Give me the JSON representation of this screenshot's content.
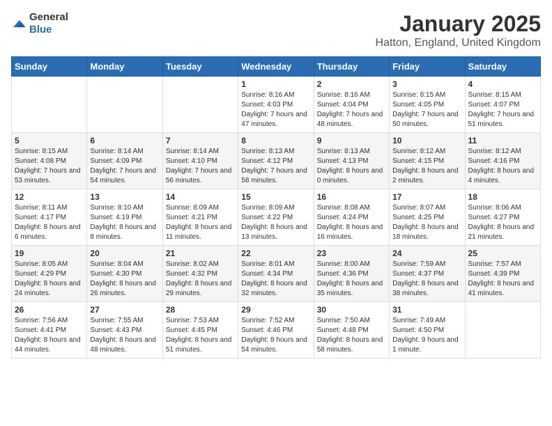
{
  "logo": {
    "general": "General",
    "blue": "Blue"
  },
  "title": "January 2025",
  "subtitle": "Hatton, England, United Kingdom",
  "weekdays": [
    "Sunday",
    "Monday",
    "Tuesday",
    "Wednesday",
    "Thursday",
    "Friday",
    "Saturday"
  ],
  "weeks": [
    [
      {
        "day": "",
        "sunrise": "",
        "sunset": "",
        "daylight": ""
      },
      {
        "day": "",
        "sunrise": "",
        "sunset": "",
        "daylight": ""
      },
      {
        "day": "",
        "sunrise": "",
        "sunset": "",
        "daylight": ""
      },
      {
        "day": "1",
        "sunrise": "Sunrise: 8:16 AM",
        "sunset": "Sunset: 4:03 PM",
        "daylight": "Daylight: 7 hours and 47 minutes."
      },
      {
        "day": "2",
        "sunrise": "Sunrise: 8:16 AM",
        "sunset": "Sunset: 4:04 PM",
        "daylight": "Daylight: 7 hours and 48 minutes."
      },
      {
        "day": "3",
        "sunrise": "Sunrise: 8:15 AM",
        "sunset": "Sunset: 4:05 PM",
        "daylight": "Daylight: 7 hours and 50 minutes."
      },
      {
        "day": "4",
        "sunrise": "Sunrise: 8:15 AM",
        "sunset": "Sunset: 4:07 PM",
        "daylight": "Daylight: 7 hours and 51 minutes."
      }
    ],
    [
      {
        "day": "5",
        "sunrise": "Sunrise: 8:15 AM",
        "sunset": "Sunset: 4:08 PM",
        "daylight": "Daylight: 7 hours and 53 minutes."
      },
      {
        "day": "6",
        "sunrise": "Sunrise: 8:14 AM",
        "sunset": "Sunset: 4:09 PM",
        "daylight": "Daylight: 7 hours and 54 minutes."
      },
      {
        "day": "7",
        "sunrise": "Sunrise: 8:14 AM",
        "sunset": "Sunset: 4:10 PM",
        "daylight": "Daylight: 7 hours and 56 minutes."
      },
      {
        "day": "8",
        "sunrise": "Sunrise: 8:13 AM",
        "sunset": "Sunset: 4:12 PM",
        "daylight": "Daylight: 7 hours and 58 minutes."
      },
      {
        "day": "9",
        "sunrise": "Sunrise: 8:13 AM",
        "sunset": "Sunset: 4:13 PM",
        "daylight": "Daylight: 8 hours and 0 minutes."
      },
      {
        "day": "10",
        "sunrise": "Sunrise: 8:12 AM",
        "sunset": "Sunset: 4:15 PM",
        "daylight": "Daylight: 8 hours and 2 minutes."
      },
      {
        "day": "11",
        "sunrise": "Sunrise: 8:12 AM",
        "sunset": "Sunset: 4:16 PM",
        "daylight": "Daylight: 8 hours and 4 minutes."
      }
    ],
    [
      {
        "day": "12",
        "sunrise": "Sunrise: 8:11 AM",
        "sunset": "Sunset: 4:17 PM",
        "daylight": "Daylight: 8 hours and 6 minutes."
      },
      {
        "day": "13",
        "sunrise": "Sunrise: 8:10 AM",
        "sunset": "Sunset: 4:19 PM",
        "daylight": "Daylight: 8 hours and 8 minutes."
      },
      {
        "day": "14",
        "sunrise": "Sunrise: 8:09 AM",
        "sunset": "Sunset: 4:21 PM",
        "daylight": "Daylight: 8 hours and 11 minutes."
      },
      {
        "day": "15",
        "sunrise": "Sunrise: 8:09 AM",
        "sunset": "Sunset: 4:22 PM",
        "daylight": "Daylight: 8 hours and 13 minutes."
      },
      {
        "day": "16",
        "sunrise": "Sunrise: 8:08 AM",
        "sunset": "Sunset: 4:24 PM",
        "daylight": "Daylight: 8 hours and 16 minutes."
      },
      {
        "day": "17",
        "sunrise": "Sunrise: 8:07 AM",
        "sunset": "Sunset: 4:25 PM",
        "daylight": "Daylight: 8 hours and 18 minutes."
      },
      {
        "day": "18",
        "sunrise": "Sunrise: 8:06 AM",
        "sunset": "Sunset: 4:27 PM",
        "daylight": "Daylight: 8 hours and 21 minutes."
      }
    ],
    [
      {
        "day": "19",
        "sunrise": "Sunrise: 8:05 AM",
        "sunset": "Sunset: 4:29 PM",
        "daylight": "Daylight: 8 hours and 24 minutes."
      },
      {
        "day": "20",
        "sunrise": "Sunrise: 8:04 AM",
        "sunset": "Sunset: 4:30 PM",
        "daylight": "Daylight: 8 hours and 26 minutes."
      },
      {
        "day": "21",
        "sunrise": "Sunrise: 8:02 AM",
        "sunset": "Sunset: 4:32 PM",
        "daylight": "Daylight: 8 hours and 29 minutes."
      },
      {
        "day": "22",
        "sunrise": "Sunrise: 8:01 AM",
        "sunset": "Sunset: 4:34 PM",
        "daylight": "Daylight: 8 hours and 32 minutes."
      },
      {
        "day": "23",
        "sunrise": "Sunrise: 8:00 AM",
        "sunset": "Sunset: 4:36 PM",
        "daylight": "Daylight: 8 hours and 35 minutes."
      },
      {
        "day": "24",
        "sunrise": "Sunrise: 7:59 AM",
        "sunset": "Sunset: 4:37 PM",
        "daylight": "Daylight: 8 hours and 38 minutes."
      },
      {
        "day": "25",
        "sunrise": "Sunrise: 7:57 AM",
        "sunset": "Sunset: 4:39 PM",
        "daylight": "Daylight: 8 hours and 41 minutes."
      }
    ],
    [
      {
        "day": "26",
        "sunrise": "Sunrise: 7:56 AM",
        "sunset": "Sunset: 4:41 PM",
        "daylight": "Daylight: 8 hours and 44 minutes."
      },
      {
        "day": "27",
        "sunrise": "Sunrise: 7:55 AM",
        "sunset": "Sunset: 4:43 PM",
        "daylight": "Daylight: 8 hours and 48 minutes."
      },
      {
        "day": "28",
        "sunrise": "Sunrise: 7:53 AM",
        "sunset": "Sunset: 4:45 PM",
        "daylight": "Daylight: 8 hours and 51 minutes."
      },
      {
        "day": "29",
        "sunrise": "Sunrise: 7:52 AM",
        "sunset": "Sunset: 4:46 PM",
        "daylight": "Daylight: 8 hours and 54 minutes."
      },
      {
        "day": "30",
        "sunrise": "Sunrise: 7:50 AM",
        "sunset": "Sunset: 4:48 PM",
        "daylight": "Daylight: 8 hours and 58 minutes."
      },
      {
        "day": "31",
        "sunrise": "Sunrise: 7:49 AM",
        "sunset": "Sunset: 4:50 PM",
        "daylight": "Daylight: 9 hours and 1 minute."
      },
      {
        "day": "",
        "sunrise": "",
        "sunset": "",
        "daylight": ""
      }
    ]
  ]
}
